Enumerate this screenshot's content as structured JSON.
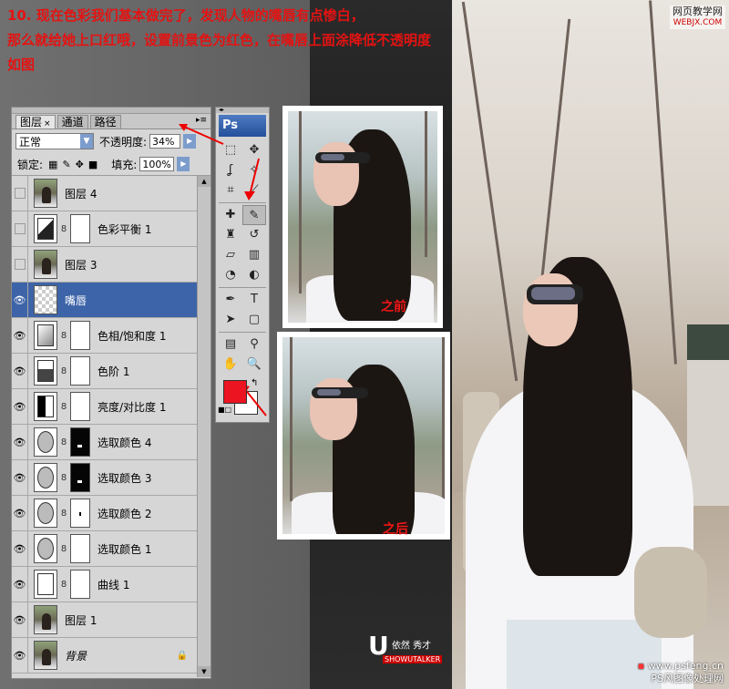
{
  "instructions": {
    "line1": "10. 现在色彩我们基本做完了，发现人物的嘴唇有点惨白，",
    "line2": "那么就给她上口红哦，设置前景色为红色，在嘴唇上面涂降低不透明度",
    "line3": "如图"
  },
  "site_logo": {
    "name": "网页教学网",
    "url": "WEBJX.COM"
  },
  "layers_panel": {
    "tabs": [
      {
        "label": "图层",
        "close": "×"
      },
      {
        "label": "通道"
      },
      {
        "label": "路径"
      }
    ],
    "blend_mode": "正常",
    "opacity_label": "不透明度:",
    "opacity_value": "34%",
    "lock_label": "锁定:",
    "fill_label": "填充:",
    "fill_value": "100%",
    "layers": [
      {
        "name": "图层 4",
        "visible": false,
        "thumb": "photo",
        "mask": null
      },
      {
        "name": "色彩平衡 1",
        "visible": false,
        "thumb": "balance",
        "mask": "white"
      },
      {
        "name": "图层 3",
        "visible": false,
        "thumb": "photo",
        "mask": null
      },
      {
        "name": "嘴唇",
        "visible": true,
        "thumb": "trans",
        "mask": null,
        "selected": true
      },
      {
        "name": "色相/饱和度 1",
        "visible": true,
        "thumb": "hue",
        "mask": "white"
      },
      {
        "name": "色阶 1",
        "visible": true,
        "thumb": "levels",
        "mask": "white"
      },
      {
        "name": "亮度/对比度 1",
        "visible": true,
        "thumb": "bright",
        "mask": "white"
      },
      {
        "name": "选取颜色 4",
        "visible": true,
        "thumb": "circle",
        "mask": "black"
      },
      {
        "name": "选取颜色 3",
        "visible": true,
        "thumb": "circle",
        "mask": "black"
      },
      {
        "name": "选取颜色 2",
        "visible": true,
        "thumb": "circle",
        "mask": "dot"
      },
      {
        "name": "选取颜色 1",
        "visible": true,
        "thumb": "circle",
        "mask": "white"
      },
      {
        "name": "曲线 1",
        "visible": true,
        "thumb": "curve",
        "mask": "white"
      },
      {
        "name": "图层 1",
        "visible": true,
        "thumb": "photo",
        "mask": null
      },
      {
        "name": "背景",
        "visible": true,
        "thumb": "photo",
        "mask": null,
        "italic": true,
        "locked": true
      }
    ]
  },
  "toolbox": {
    "logo": "Ps",
    "foreground_color": "#ec1421",
    "background_color": "#ffffff",
    "tools": [
      "marquee-tool",
      "move-tool",
      "lasso-tool",
      "magic-wand-tool",
      "crop-tool",
      "slice-tool",
      "healing-brush-tool",
      "brush-tool",
      "clone-stamp-tool",
      "history-brush-tool",
      "eraser-tool",
      "gradient-tool",
      "blur-tool",
      "dodge-tool",
      "pen-tool",
      "type-tool",
      "path-selection-tool",
      "shape-tool",
      "notes-tool",
      "eyedropper-tool",
      "hand-tool",
      "zoom-tool"
    ],
    "active_tool": "brush-tool"
  },
  "captions": {
    "before": "之前",
    "after": "之后"
  },
  "watermark": {
    "letter": "U",
    "text": "依然 秀才",
    "sub": "SHOWUTALKER"
  },
  "footer": {
    "url": "www.psfeng.cn",
    "name": "PS风图像处理网"
  }
}
